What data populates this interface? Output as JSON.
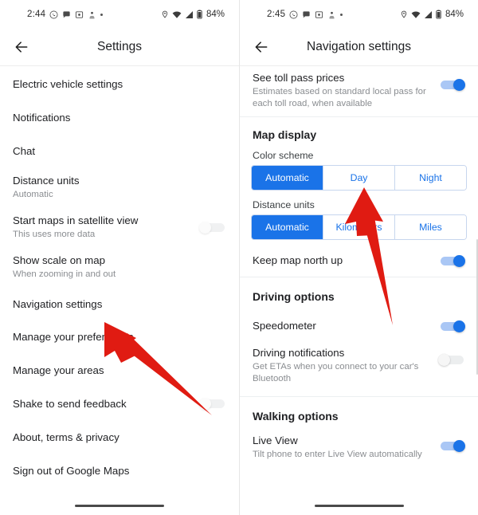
{
  "meta": {
    "accent_blue": "#1a73e8",
    "arrow_red": "#e01b12",
    "text_primary": "#202124",
    "text_secondary": "#8a8d91"
  },
  "left_panel": {
    "status_bar": {
      "time": "2:44",
      "battery_percent": "84%",
      "left_icons": [
        "whatsapp-icon",
        "chat-bubble-icon",
        "screenshot-icon",
        "download-icon",
        "more-dot-icon"
      ],
      "right_icons": [
        "location-pin-icon",
        "wifi-icon",
        "signal-icon",
        "battery-icon"
      ]
    },
    "appbar": {
      "back_icon": "back-arrow-icon",
      "title": "Settings"
    },
    "items": [
      {
        "title": "Electric vehicle settings",
        "sub": "",
        "toggle": null
      },
      {
        "title": "Notifications",
        "sub": "",
        "toggle": null
      },
      {
        "title": "Chat",
        "sub": "",
        "toggle": null
      },
      {
        "title": "Distance units",
        "sub": "Automatic",
        "toggle": null
      },
      {
        "title": "Start maps in satellite view",
        "sub": "This uses more data",
        "toggle": "off"
      },
      {
        "title": "Show scale on map",
        "sub": "When zooming in and out",
        "toggle": null
      },
      {
        "title": "Navigation settings",
        "sub": "",
        "toggle": null
      },
      {
        "title": "Manage your preferences",
        "sub": "",
        "toggle": null
      },
      {
        "title": "Manage your areas",
        "sub": "",
        "toggle": null
      },
      {
        "title": "Shake to send feedback",
        "sub": "",
        "toggle": "off"
      },
      {
        "title": "About, terms & privacy",
        "sub": "",
        "toggle": null
      },
      {
        "title": "Sign out of Google Maps",
        "sub": "",
        "toggle": null
      }
    ]
  },
  "right_panel": {
    "status_bar": {
      "time": "2:45",
      "battery_percent": "84%",
      "left_icons": [
        "whatsapp-icon",
        "chat-bubble-icon",
        "screenshot-icon",
        "download-icon",
        "more-dot-icon"
      ],
      "right_icons": [
        "location-pin-icon",
        "wifi-icon",
        "signal-icon",
        "battery-icon"
      ]
    },
    "appbar": {
      "back_icon": "back-arrow-icon",
      "title": "Navigation settings"
    },
    "toll_row": {
      "title": "See toll pass prices",
      "sub": "Estimates based on standard local pass for each toll road, when available",
      "toggle": "on"
    },
    "map_display": {
      "heading": "Map display",
      "color_scheme": {
        "label": "Color scheme",
        "options": [
          "Automatic",
          "Day",
          "Night"
        ],
        "selected": "Automatic"
      },
      "distance_units": {
        "label": "Distance units",
        "options": [
          "Automatic",
          "Kilometers",
          "Miles"
        ],
        "selected": "Automatic"
      },
      "keep_north": {
        "title": "Keep map north up",
        "sub": "",
        "toggle": "on"
      }
    },
    "driving_options": {
      "heading": "Driving options",
      "items": [
        {
          "title": "Speedometer",
          "sub": "",
          "toggle": "on"
        },
        {
          "title": "Driving notifications",
          "sub": "Get ETAs when you connect to your car's Bluetooth",
          "toggle": "off"
        }
      ]
    },
    "walking_options": {
      "heading": "Walking options",
      "items": [
        {
          "title": "Live View",
          "sub": "Tilt phone to enter Live View automatically",
          "toggle": "on"
        }
      ]
    }
  },
  "annotations": [
    {
      "name": "arrow-to-navigation-settings",
      "color": "#e01b12"
    },
    {
      "name": "arrow-to-day-option",
      "color": "#e01b12"
    }
  ]
}
